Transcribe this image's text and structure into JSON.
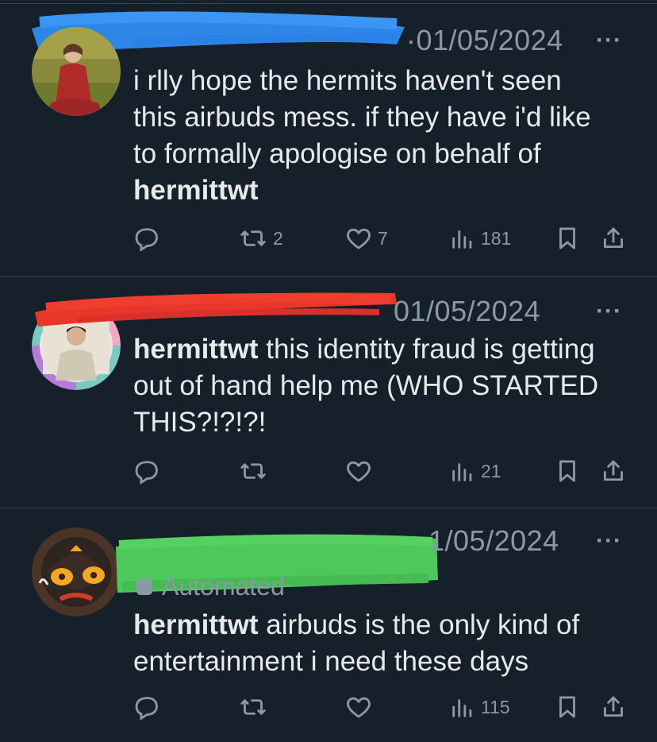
{
  "tweets": [
    {
      "date": "01/05/2024",
      "separator": "·",
      "more": "···",
      "text_plain": "i rlly hope the hermits haven't seen this airbuds mess. if they have i'd like to formally apologise on behalf of ",
      "text_bold": "hermittwt",
      "text_after": "",
      "stats": {
        "reply": "",
        "retweet": "2",
        "like": "7",
        "views": "181"
      }
    },
    {
      "date": "01/05/2024",
      "more": "···",
      "text_bold": "hermittwt",
      "text_plain": " this identity fraud is getting out of hand help me (WHO STARTED THIS?!?!?!",
      "stats": {
        "reply": "",
        "retweet": "",
        "like": "",
        "views": "21"
      }
    },
    {
      "date": "1/05/2024",
      "more": "···",
      "automated_label": "Automated",
      "text_bold": "hermittwt",
      "text_plain": " airbuds is the only kind of entertainment i need these days",
      "stats": {
        "reply": "",
        "retweet": "",
        "like": "",
        "views": "115"
      }
    }
  ],
  "colors": {
    "background": "#15202b",
    "text": "#e7e9ea",
    "muted": "#8b98a5",
    "divider": "#38444d",
    "redact_blue": "#2f8cf0",
    "redact_red": "#e8362b",
    "redact_green": "#4cc95a"
  },
  "icons": [
    "reply-icon",
    "retweet-icon",
    "like-icon",
    "views-icon",
    "bookmark-icon",
    "share-icon",
    "more-icon"
  ]
}
